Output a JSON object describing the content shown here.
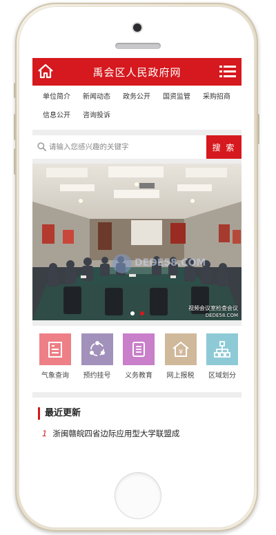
{
  "colors": {
    "brand_red": "#d5191e",
    "page_bg": "#eeeeee"
  },
  "header": {
    "title": "禹会区人民政府网",
    "home_icon": "home-icon",
    "menu_icon": "menu-icon"
  },
  "nav": {
    "items": [
      {
        "label": "单位简介"
      },
      {
        "label": "新闻动态"
      },
      {
        "label": "政务公开"
      },
      {
        "label": "国资监管"
      },
      {
        "label": "采购招商"
      },
      {
        "label": "信息公开"
      },
      {
        "label": "咨询投诉"
      }
    ]
  },
  "search": {
    "placeholder": "请输入您感兴趣的关键字",
    "value": "",
    "button_label": "搜 索",
    "icon": "search-icon"
  },
  "banner": {
    "caption": "视频会议室检查会议",
    "watermark": "DEDE58.COM",
    "slide_count": 2,
    "active_slide": 2,
    "dot_colors": {
      "active": "#d5191e",
      "inactive": "#ffffff"
    }
  },
  "services": [
    {
      "label": "气象查询",
      "icon": "document-list-icon",
      "color": "#ee7f86"
    },
    {
      "label": "预约挂号",
      "icon": "share-nodes-icon",
      "color": "#a291ba"
    },
    {
      "label": "义务教育",
      "icon": "document-icon",
      "color": "#c97fc9"
    },
    {
      "label": "网上报税",
      "icon": "yen-house-icon",
      "color": "#d0b89b"
    },
    {
      "label": "区域划分",
      "icon": "hierarchy-icon",
      "color": "#8ecad6"
    }
  ],
  "recent": {
    "heading": "最近更新",
    "items": [
      {
        "num": "1",
        "title": "浙闽赣皖四省边际应用型大学联盟成"
      }
    ]
  }
}
